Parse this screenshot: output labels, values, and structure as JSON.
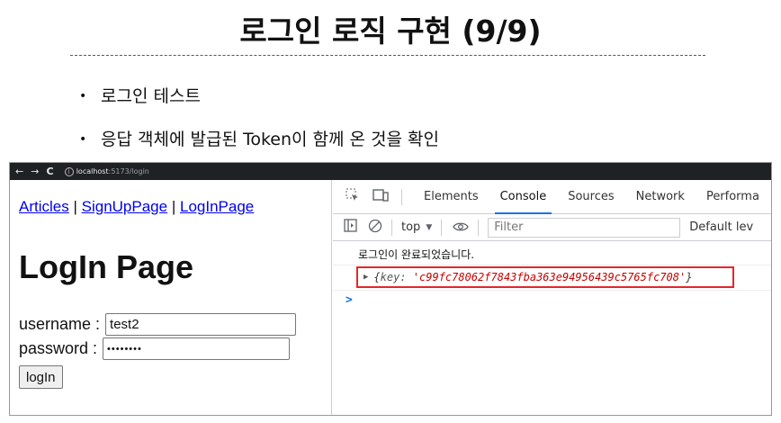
{
  "slide": {
    "title": "로그인 로직 구현 (9/9)",
    "bullets": [
      "로그인 테스트",
      "응답 객체에 발급된 Token이 함께 온 것을 확인"
    ],
    "bullet_glyph": "•"
  },
  "browser": {
    "nav": {
      "back": "←",
      "forward": "→",
      "reload": "C",
      "info": "i"
    },
    "url_host": "localhost",
    "url_path": ":5173/login"
  },
  "page": {
    "links": [
      "Articles",
      "SignUpPage",
      "LogInPage"
    ],
    "separator": "|",
    "heading": "LogIn Page",
    "username_label": "username :",
    "username_value": "test2",
    "password_label": "password :",
    "password_value": "••••••••",
    "login_button": "logIn"
  },
  "devtools": {
    "tabs": [
      "Elements",
      "Console",
      "Sources",
      "Network",
      "Performa"
    ],
    "active_tab": "Console",
    "top_context": "top",
    "filter_placeholder": "Filter",
    "levels_label": "Default lev",
    "log_message": "로그인이 완료되었습니다.",
    "object_open": "{",
    "object_key": "key:",
    "object_value": "'c99fc78062f7843fba363e94956439c5765fc708'",
    "object_close": "}",
    "prompt": ">",
    "highlight_color": "#e3272b"
  }
}
